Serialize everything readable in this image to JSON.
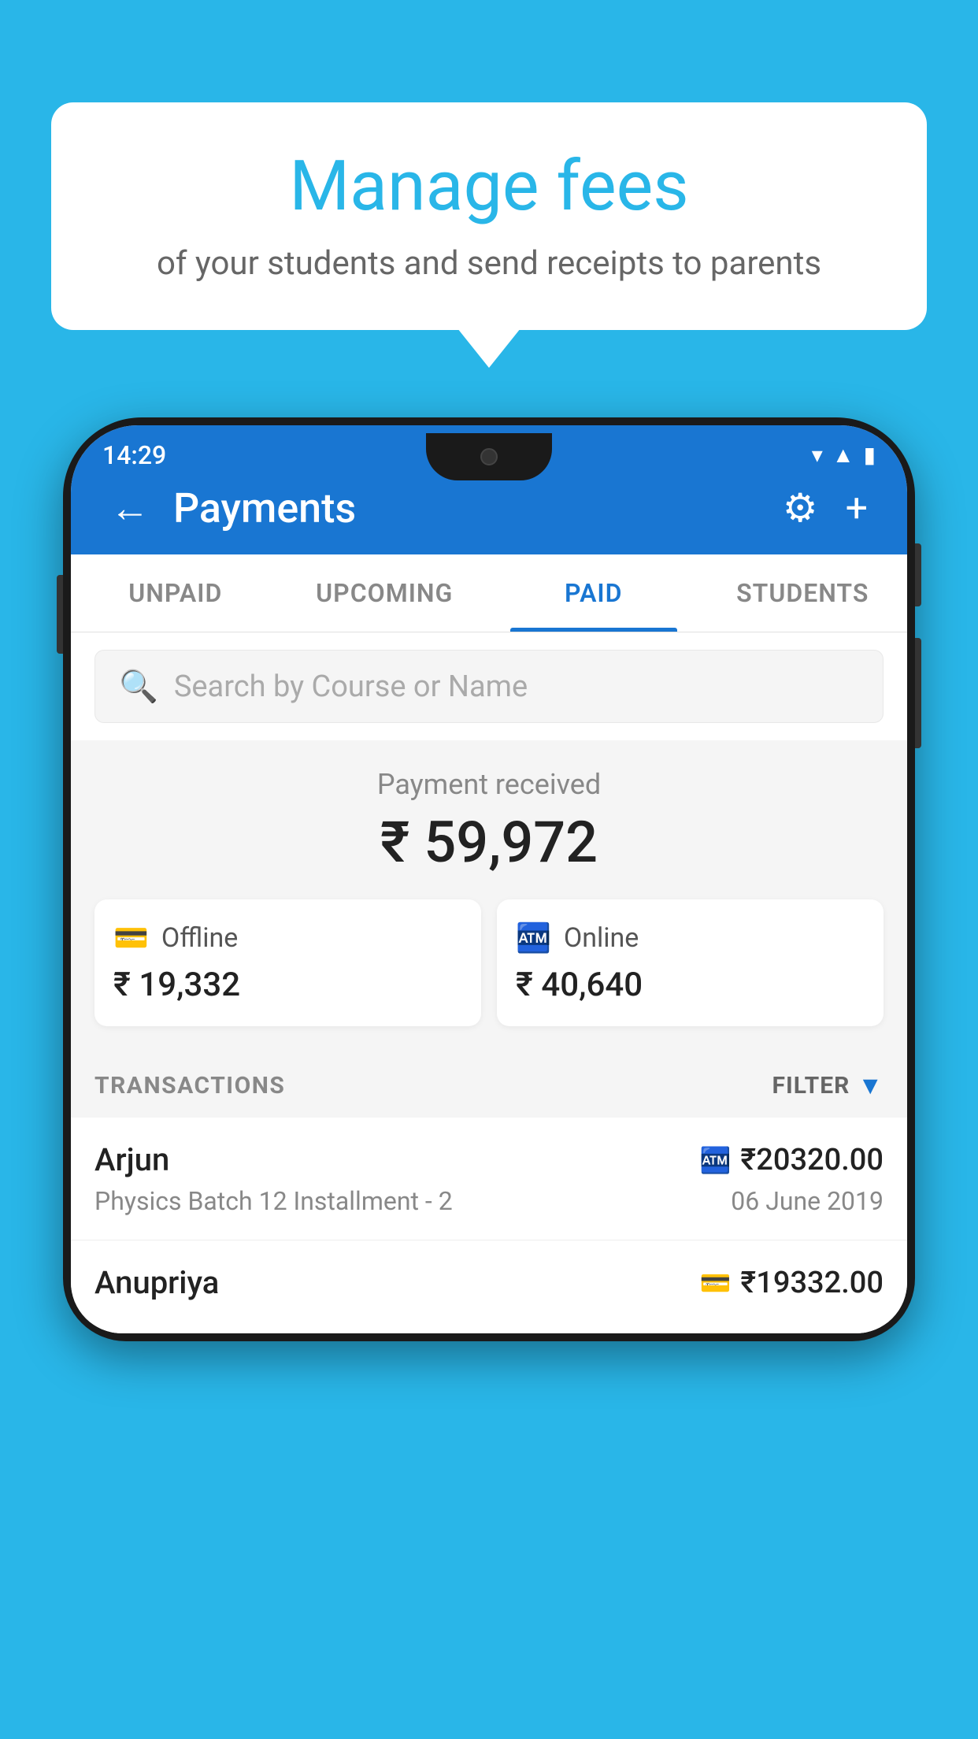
{
  "background_color": "#29b6e8",
  "speech_bubble": {
    "title": "Manage fees",
    "subtitle": "of your students and send receipts to parents"
  },
  "phone": {
    "status_bar": {
      "time": "14:29",
      "icons": [
        "wifi",
        "signal",
        "battery"
      ]
    },
    "header": {
      "title": "Payments",
      "back_label": "←",
      "settings_icon": "gear",
      "add_icon": "+"
    },
    "tabs": [
      {
        "label": "UNPAID",
        "active": false
      },
      {
        "label": "UPCOMING",
        "active": false
      },
      {
        "label": "PAID",
        "active": true
      },
      {
        "label": "STUDENTS",
        "active": false
      }
    ],
    "search": {
      "placeholder": "Search by Course or Name"
    },
    "payment_summary": {
      "label": "Payment received",
      "total": "₹ 59,972",
      "offline": {
        "type": "Offline",
        "amount": "₹ 19,332"
      },
      "online": {
        "type": "Online",
        "amount": "₹ 40,640"
      }
    },
    "transactions": {
      "section_label": "TRANSACTIONS",
      "filter_label": "FILTER",
      "items": [
        {
          "name": "Arjun",
          "course": "Physics Batch 12 Installment - 2",
          "amount": "₹20320.00",
          "date": "06 June 2019",
          "payment_type": "online"
        },
        {
          "name": "Anupriya",
          "course": "",
          "amount": "₹19332.00",
          "date": "",
          "payment_type": "offline"
        }
      ]
    }
  }
}
